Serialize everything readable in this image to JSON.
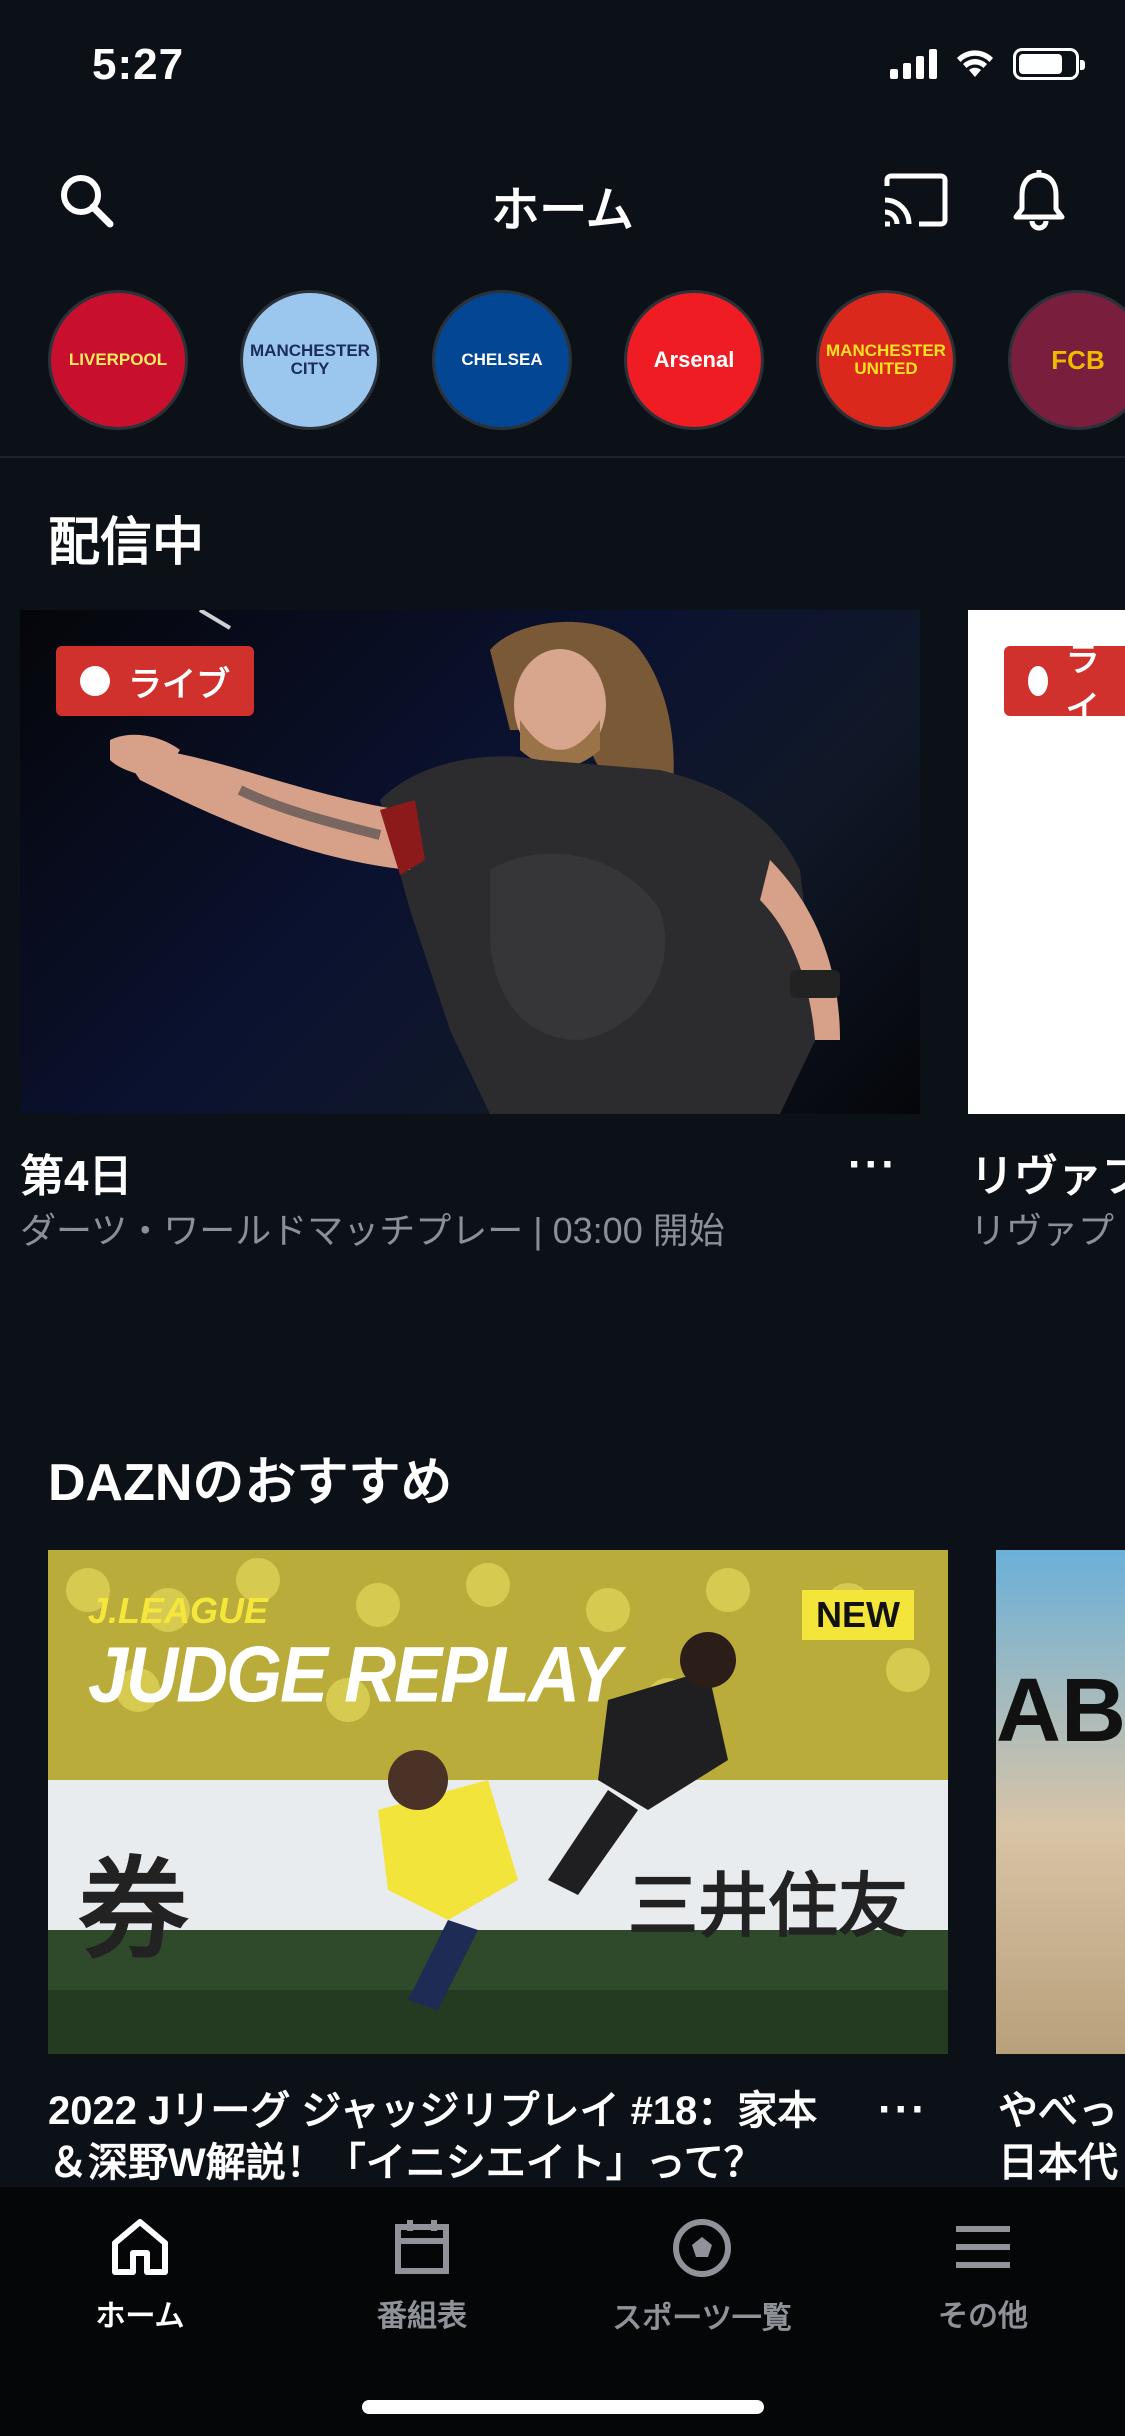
{
  "status": {
    "time": "5:27"
  },
  "header": {
    "title": "ホーム"
  },
  "teams": [
    {
      "name": "LIVERPOOL",
      "color": "#c8102e",
      "text": "#f6eb61"
    },
    {
      "name": "MANCHESTER CITY",
      "color": "#9bc6ee",
      "text": "#1c2c5b"
    },
    {
      "name": "CHELSEA",
      "color": "#034694",
      "text": "#ffffff"
    },
    {
      "name": "Arsenal",
      "color": "#ef1c24",
      "text": "#ffffff"
    },
    {
      "name": "MANCHESTER UNITED",
      "color": "#da291c",
      "text": "#fbe122"
    },
    {
      "name": "FCB",
      "color": "#7a1e3e",
      "text": "#edbb00"
    }
  ],
  "live_section": {
    "title": "配信中",
    "badge": "ライブ",
    "card1": {
      "title": "第4日",
      "subtitle": "ダーツ・ワールドマッチプレー | 03:00 開始",
      "more": "···"
    },
    "card2": {
      "title": "リヴァプ",
      "subtitle": "リヴァプ",
      "badge": "ライ"
    }
  },
  "rec_section": {
    "title": "DAZNのおすすめ",
    "card1": {
      "league": "J.LEAGUE",
      "heading": "JUDGE REPLAY",
      "new_badge": "NEW",
      "banner": "券",
      "banner2": "三井住友",
      "title_line1": "2022 Jリーグ ジャッジリプレイ #18：家本",
      "title_line2": "＆深野W解説！「イニシエイト」って？",
      "more": "···"
    },
    "card2": {
      "title_line1": "やべっ",
      "title_line2": "日本代",
      "banner": "ABI"
    }
  },
  "nav": {
    "items": [
      {
        "label": "ホーム",
        "icon": "home-icon",
        "active": true
      },
      {
        "label": "番組表",
        "icon": "calendar-icon",
        "active": false
      },
      {
        "label": "スポーツ一覧",
        "icon": "sports-ball-icon",
        "active": false
      },
      {
        "label": "その他",
        "icon": "menu-icon",
        "active": false
      }
    ]
  }
}
